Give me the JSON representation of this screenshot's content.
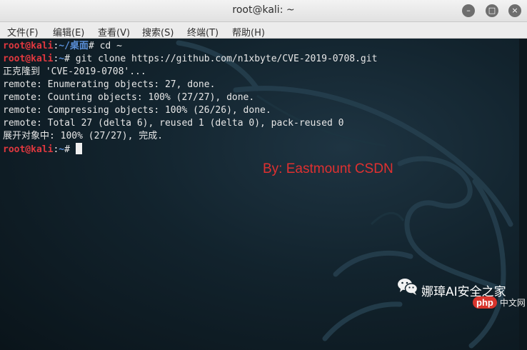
{
  "window": {
    "title": "root@kali: ~",
    "controls": {
      "minimize": "–",
      "maximize": "□",
      "close": "×"
    }
  },
  "menu": {
    "items": [
      "文件(F)",
      "编辑(E)",
      "查看(V)",
      "搜索(S)",
      "终端(T)",
      "帮助(H)"
    ]
  },
  "terminal": {
    "lines": [
      {
        "user": "root@kali",
        "sep": ":",
        "path": "~/桌面",
        "prompt": "# ",
        "cmd": "cd ~"
      },
      {
        "user": "root@kali",
        "sep": ":",
        "path": "~",
        "prompt": "# ",
        "cmd": "git clone https://github.com/n1xbyte/CVE-2019-0708.git"
      },
      {
        "out": "正克隆到 'CVE-2019-0708'..."
      },
      {
        "out": "remote: Enumerating objects: 27, done."
      },
      {
        "out": "remote: Counting objects: 100% (27/27), done."
      },
      {
        "out": "remote: Compressing objects: 100% (26/26), done."
      },
      {
        "out": "remote: Total 27 (delta 6), reused 1 (delta 0), pack-reused 0"
      },
      {
        "out": "展开对象中: 100% (27/27), 完成."
      },
      {
        "user": "root@kali",
        "sep": ":",
        "path": "~",
        "prompt": "# ",
        "cmd": ""
      }
    ]
  },
  "overlay": {
    "watermark": "By:  Eastmount CSDN",
    "wechat_account": "娜璋AI安全之家",
    "php_badge": "php",
    "php_rest": "中文网"
  },
  "colors": {
    "user": "#e0383f",
    "path": "#5a8fd8",
    "text": "#e7e7e7",
    "background": "#12232d"
  }
}
